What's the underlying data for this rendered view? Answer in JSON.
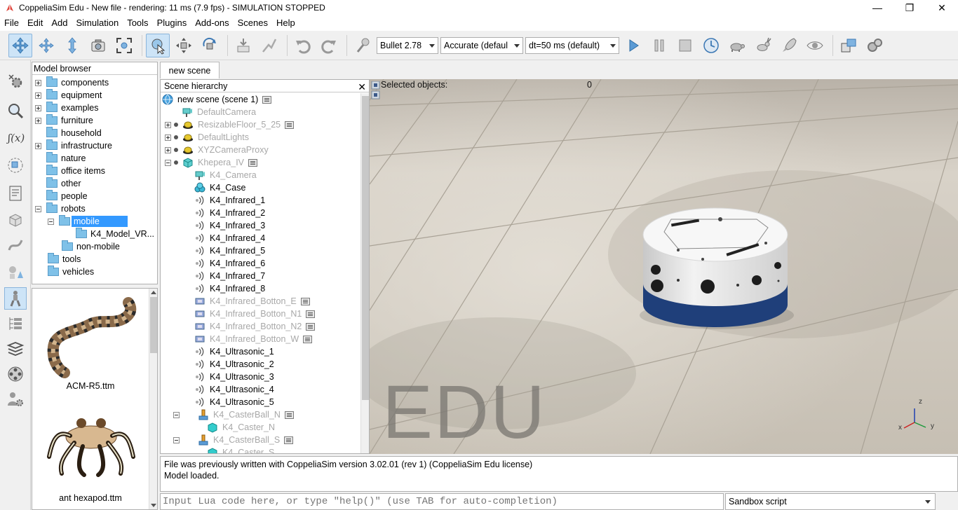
{
  "window": {
    "title": "CoppeliaSim Edu - New file - rendering: 11 ms (7.9 fps) - SIMULATION STOPPED",
    "minimize": "—",
    "maximize": "❐",
    "close": "✕"
  },
  "menu": [
    "File",
    "Edit",
    "Add",
    "Simulation",
    "Tools",
    "Plugins",
    "Add-ons",
    "Scenes",
    "Help"
  ],
  "toolbar": {
    "physics_engine": "Bullet 2.78",
    "accuracy": "Accurate (defaul",
    "timestep": "dt=50 ms (default)"
  },
  "model_browser": {
    "header": "Model browser",
    "items": [
      {
        "label": "components"
      },
      {
        "label": "equipment"
      },
      {
        "label": "examples"
      },
      {
        "label": "furniture"
      },
      {
        "label": "household"
      },
      {
        "label": "infrastructure"
      },
      {
        "label": "nature"
      },
      {
        "label": "office items"
      },
      {
        "label": "other"
      },
      {
        "label": "people"
      },
      {
        "label": "robots"
      },
      {
        "label": "mobile"
      },
      {
        "label": "K4_Model_VR..."
      },
      {
        "label": "non-mobile"
      },
      {
        "label": "tools"
      },
      {
        "label": "vehicles"
      }
    ],
    "selected": "mobile"
  },
  "thumbnails": [
    {
      "caption": "ACM-R5.ttm"
    },
    {
      "caption": "ant hexapod.ttm"
    }
  ],
  "scene_tab": "new scene",
  "scene_hierarchy": {
    "header": "Scene hierarchy",
    "close": "✕",
    "rows": [
      {
        "label": "new scene (scene 1)"
      },
      {
        "label": "DefaultCamera"
      },
      {
        "label": "ResizableFloor_5_25"
      },
      {
        "label": "DefaultLights"
      },
      {
        "label": "XYZCameraProxy"
      },
      {
        "label": "Khepera_IV"
      },
      {
        "label": "K4_Camera"
      },
      {
        "label": "K4_Case"
      },
      {
        "label": "K4_Infrared_1"
      },
      {
        "label": "K4_Infrared_2"
      },
      {
        "label": "K4_Infrared_3"
      },
      {
        "label": "K4_Infrared_4"
      },
      {
        "label": "K4_Infrared_5"
      },
      {
        "label": "K4_Infrared_6"
      },
      {
        "label": "K4_Infrared_7"
      },
      {
        "label": "K4_Infrared_8"
      },
      {
        "label": "K4_Infrared_Botton_E"
      },
      {
        "label": "K4_Infrared_Botton_N1"
      },
      {
        "label": "K4_Infrared_Botton_N2"
      },
      {
        "label": "K4_Infrared_Botton_W"
      },
      {
        "label": "K4_Ultrasonic_1"
      },
      {
        "label": "K4_Ultrasonic_2"
      },
      {
        "label": "K4_Ultrasonic_3"
      },
      {
        "label": "K4_Ultrasonic_4"
      },
      {
        "label": "K4_Ultrasonic_5"
      },
      {
        "label": "K4_CasterBall_N"
      },
      {
        "label": "K4_Caster_N"
      },
      {
        "label": "K4_CasterBall_S"
      },
      {
        "label": "K4_Caster_S"
      }
    ]
  },
  "viewport": {
    "selected_label": "Selected objects:",
    "selected_count": "0",
    "watermark": "EDU",
    "axes": {
      "x": "x",
      "y": "y",
      "z": "z"
    }
  },
  "console": {
    "lines": [
      "File was previously written with CoppeliaSim version 3.02.01 (rev 1) (CoppeliaSim Edu license)",
      "Model loaded."
    ]
  },
  "lua_input": {
    "placeholder": "Input Lua code here, or type \"help()\" (use TAB for auto-completion)"
  },
  "script_selector": "Sandbox script"
}
